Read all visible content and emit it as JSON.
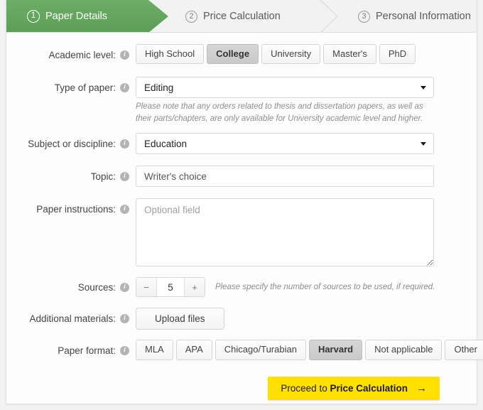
{
  "steps": [
    {
      "number": "1",
      "label": "Paper Details",
      "state": "active"
    },
    {
      "number": "2",
      "label": "Price Calculation",
      "state": "inactive"
    },
    {
      "number": "3",
      "label": "Personal Information",
      "state": "inactive"
    }
  ],
  "colors": {
    "active_step_green": "#5c9e57",
    "proceed_yellow": "#ffe000",
    "selected_button_gray": "#cfcfcf"
  },
  "icons": {
    "info": "i",
    "caret_down": "chevron-down-icon",
    "arrow_right": "→",
    "minus": "−",
    "plus": "+"
  },
  "form": {
    "academic_level": {
      "label": "Academic level:",
      "options": [
        "High School",
        "College",
        "University",
        "Master's",
        "PhD"
      ],
      "selected": "College"
    },
    "type_of_paper": {
      "label": "Type of paper:",
      "value": "Editing",
      "hint": "Please note that any orders related to thesis and dissertation papers, as well as their parts/chapters, are only available for University academic level and higher."
    },
    "subject": {
      "label": "Subject or discipline:",
      "value": "Education"
    },
    "topic": {
      "label": "Topic:",
      "value": "Writer's choice",
      "placeholder": "Writer's choice"
    },
    "paper_instructions": {
      "label": "Paper instructions:",
      "value": "",
      "placeholder": "Optional field"
    },
    "sources": {
      "label": "Sources:",
      "value": "5",
      "hint": "Please specify the number of sources to be used, if required."
    },
    "additional_materials": {
      "label": "Additional materials:",
      "button_label": "Upload files"
    },
    "paper_format": {
      "label": "Paper format:",
      "options": [
        "MLA",
        "APA",
        "Chicago/Turabian",
        "Harvard",
        "Not applicable",
        "Other"
      ],
      "selected": "Harvard"
    }
  },
  "footer": {
    "proceed_prefix": "Proceed to ",
    "proceed_strong": "Price Calculation",
    "proceed_arrow": "→"
  }
}
